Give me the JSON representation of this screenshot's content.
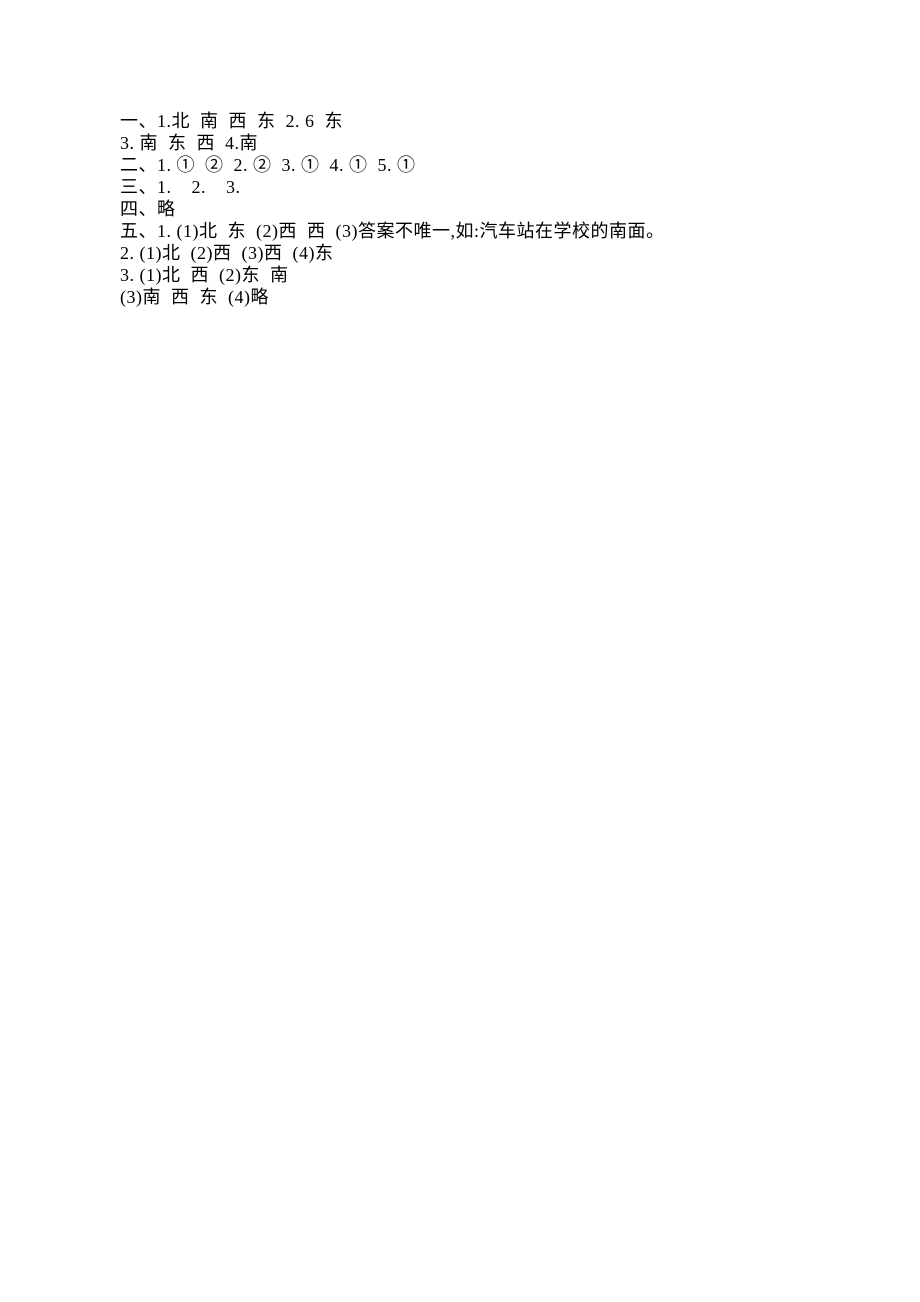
{
  "lines": [
    "一、1.北  南  西  东  2. 6  东",
    "3. 南  东  西  4.南",
    "二、1. ①  ②  2. ②  3. ①  4. ①  5. ①",
    "三、1.    2.    3.",
    "四、略",
    "五、1. (1)北  东  (2)西  西  (3)答案不唯一,如:汽车站在学校的南面。",
    "2. (1)北  (2)西  (3)西  (4)东",
    "3. (1)北  西  (2)东  南",
    "(3)南  西  东  (4)略"
  ]
}
